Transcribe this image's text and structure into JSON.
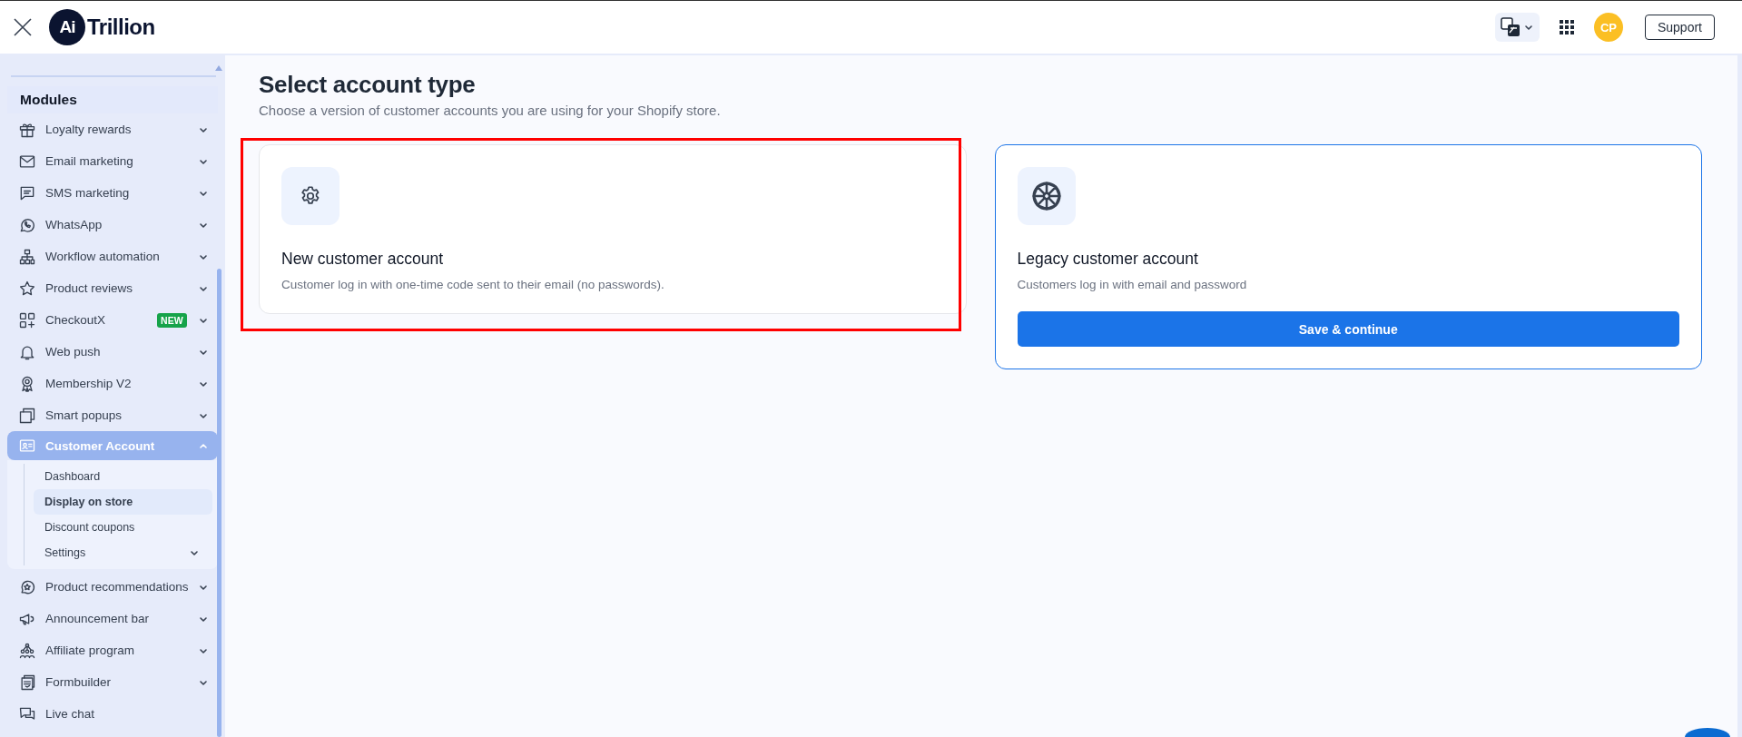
{
  "topbar": {
    "logo_mark": "Ai",
    "logo_text": "Trillion",
    "avatar": "CP",
    "support_button": "Support"
  },
  "sidebar": {
    "section": "Modules",
    "items": [
      {
        "label": "Loyalty rewards",
        "kind": "menu",
        "expanded": false,
        "selected": false
      },
      {
        "label": "Email marketing",
        "kind": "menu",
        "expanded": false,
        "selected": false
      },
      {
        "label": "SMS marketing",
        "kind": "menu",
        "expanded": false,
        "selected": false
      },
      {
        "label": "WhatsApp",
        "kind": "menu",
        "expanded": false,
        "selected": false
      },
      {
        "label": "Workflow automation",
        "kind": "menu",
        "expanded": false,
        "selected": false
      },
      {
        "label": "Product reviews",
        "kind": "menu",
        "expanded": false,
        "selected": false
      },
      {
        "label": "CheckoutX",
        "kind": "menu",
        "badge": "NEW",
        "expanded": false,
        "selected": false
      },
      {
        "label": "Web push",
        "kind": "menu",
        "expanded": false,
        "selected": false
      },
      {
        "label": "Membership V2",
        "kind": "menu",
        "expanded": false,
        "selected": false
      },
      {
        "label": "Smart popups",
        "kind": "menu",
        "expanded": false,
        "selected": false
      },
      {
        "label": "Customer Account",
        "kind": "menu",
        "expanded": true,
        "selected": true,
        "children": [
          {
            "label": "Dashboard",
            "kind": "link",
            "selected": false
          },
          {
            "label": "Display on store",
            "kind": "link",
            "selected": true
          },
          {
            "label": "Discount coupons",
            "kind": "link",
            "selected": false
          },
          {
            "label": "Settings",
            "kind": "menu",
            "expanded": false,
            "selected": false
          }
        ]
      },
      {
        "label": "Product recommendations",
        "kind": "menu",
        "expanded": false,
        "selected": false
      },
      {
        "label": "Announcement bar",
        "kind": "menu",
        "expanded": false,
        "selected": false
      },
      {
        "label": "Affiliate program",
        "kind": "menu",
        "expanded": false,
        "selected": false
      },
      {
        "label": "Formbuilder",
        "kind": "menu",
        "expanded": false,
        "selected": false
      },
      {
        "label": "Live chat",
        "kind": "link",
        "selected": false
      }
    ]
  },
  "main": {
    "title": "Select account type",
    "subtitle": "Choose a version of customer accounts you are using for your Shopify store.",
    "cards": [
      {
        "title": "New customer account",
        "description": "Customer log in with one-time code sent to their email (no passwords).",
        "selected": false,
        "highlighted": true
      },
      {
        "title": "Legacy customer account",
        "description": "Customers log in with email and password",
        "selected": true,
        "highlighted": false,
        "button": "Save & continue"
      }
    ]
  }
}
